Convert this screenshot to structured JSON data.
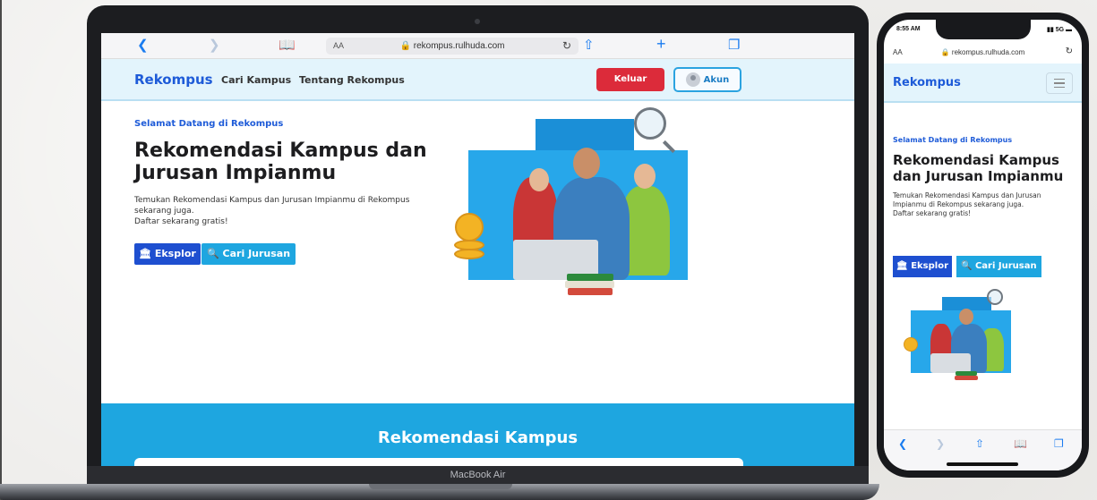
{
  "browser": {
    "url": "rekompus.rulhuda.com",
    "text_size_label": "AA"
  },
  "site": {
    "brand": "Rekompus",
    "nav_links": [
      "Cari Kampus",
      "Tentang Rekompus"
    ],
    "logout_label": "Keluar",
    "account_label": "Akun",
    "hero": {
      "kicker": "Selamat Datang di Rekompus",
      "title": "Rekomendasi Kampus dan Jurusan Impianmu",
      "description": "Temukan Rekomendasi Kampus dan Jurusan Impianmu di Rekompus sekarang juga.",
      "cta_text": "Daftar sekarang gratis!",
      "explore_label": "Eksplor",
      "search_major_label": "Cari Jurusan"
    },
    "section_title": "Rekomendasi Kampus"
  },
  "device": {
    "laptop_label": "MacBook Air"
  },
  "phone_status": {
    "time": "8:55 AM",
    "signal": "5G"
  },
  "colors": {
    "brand_blue": "#1e5bd8",
    "accent_cyan": "#1ea6e0",
    "logout_red": "#dc2b3a",
    "nav_bg": "#e3f4fc"
  },
  "icons": {
    "back": "chevron-left-icon",
    "forward": "chevron-right-icon",
    "bookmarks": "book-icon",
    "lock": "lock-icon",
    "reload": "reload-icon",
    "share": "share-icon",
    "new_tab": "plus-icon",
    "tabs": "tabs-icon",
    "explore": "bank-icon",
    "search": "search-icon",
    "menu": "hamburger-menu-icon",
    "avatar": "user-avatar-icon"
  }
}
